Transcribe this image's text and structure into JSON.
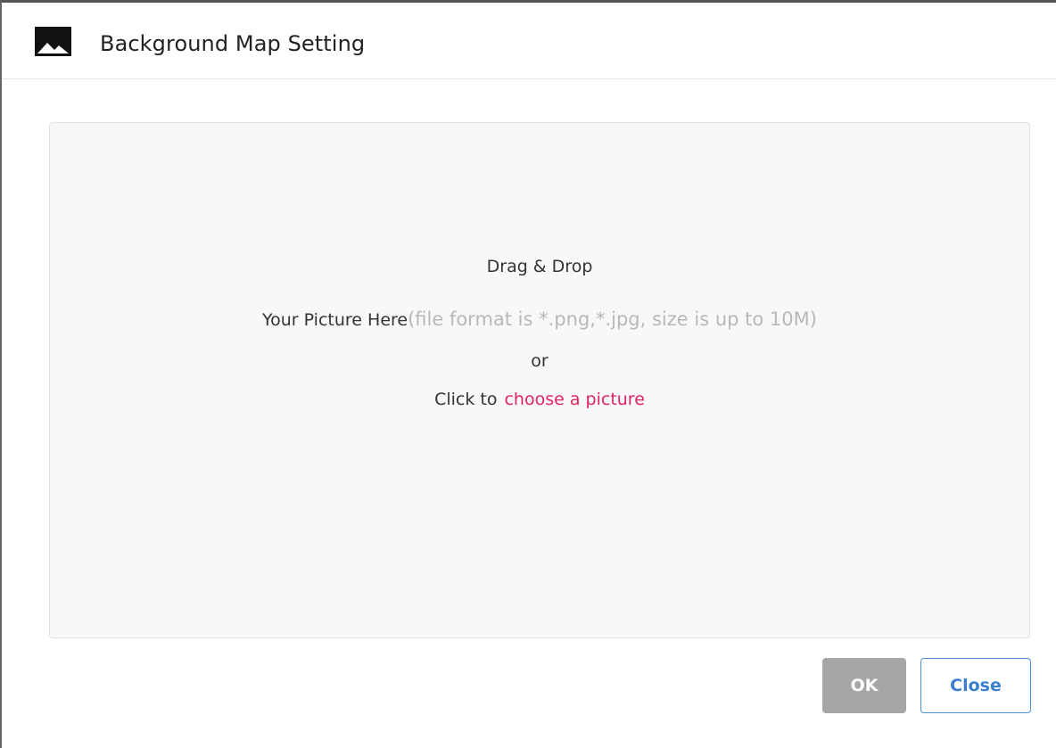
{
  "dialog": {
    "title": "Background Map Setting",
    "icon": "image-icon"
  },
  "dropzone": {
    "title": "Drag & Drop",
    "picture_label": "Your Picture Here",
    "picture_hint": "(file format is *.png,*.jpg, size is up to 10M)",
    "or_label": "or",
    "click_label": "Click to",
    "choose_link": "choose a picture"
  },
  "buttons": {
    "ok_label": "OK",
    "close_label": "Close"
  },
  "colors": {
    "link": "#e0245e",
    "ok_disabled": "#a6a6a6",
    "close_border": "#4a90d9"
  }
}
